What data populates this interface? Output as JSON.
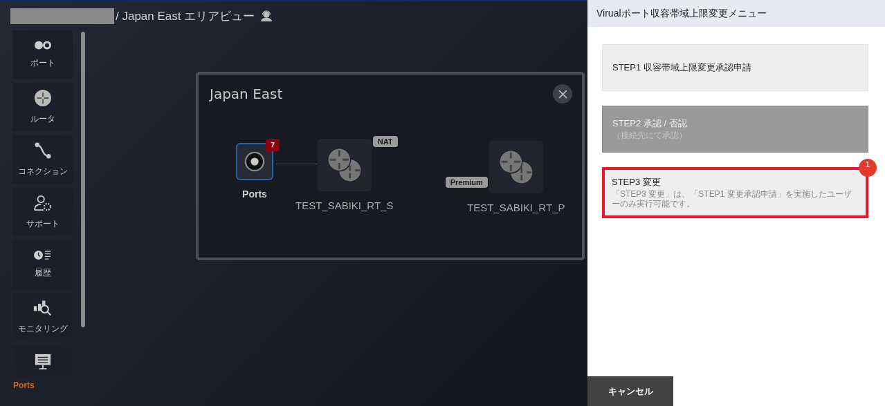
{
  "header": {
    "title": "/ Japan East エリアビュー",
    "redacted": true
  },
  "sidebar": {
    "items": [
      {
        "label": "ポート"
      },
      {
        "label": "ルータ"
      },
      {
        "label": "コネクション"
      },
      {
        "label": "サポート"
      },
      {
        "label": "履歴"
      },
      {
        "label": "モニタリング"
      },
      {
        "label": "Ports"
      }
    ]
  },
  "area_panel": {
    "title": "Japan East",
    "nodes": [
      {
        "kind": "port",
        "label": "Ports",
        "badge": "7",
        "selected": true
      },
      {
        "kind": "router",
        "label": "TEST_SABIKI_RT_S",
        "tag": "NAT"
      },
      {
        "kind": "router",
        "label": "TEST_SABIKI_RT_P",
        "tag": "Premium"
      }
    ]
  },
  "menu": {
    "title": "Virualポート収容帯域上限変更メニュー",
    "steps": [
      {
        "title": "STEP1 収容帯域上限変更承認申請",
        "disabled": false,
        "highlighted": false
      },
      {
        "title": "STEP2 承認 / 否認",
        "note": "（接続先にて承認）",
        "disabled": true,
        "highlighted": false
      },
      {
        "title": "STEP3 変更",
        "note": "「STEP3 変更」は、「STEP1 変更承認申請」を実施したユーザーのみ実行可能です。",
        "disabled": false,
        "highlighted": true,
        "badge": "1"
      }
    ],
    "cancel_button": "キャンセル"
  }
}
